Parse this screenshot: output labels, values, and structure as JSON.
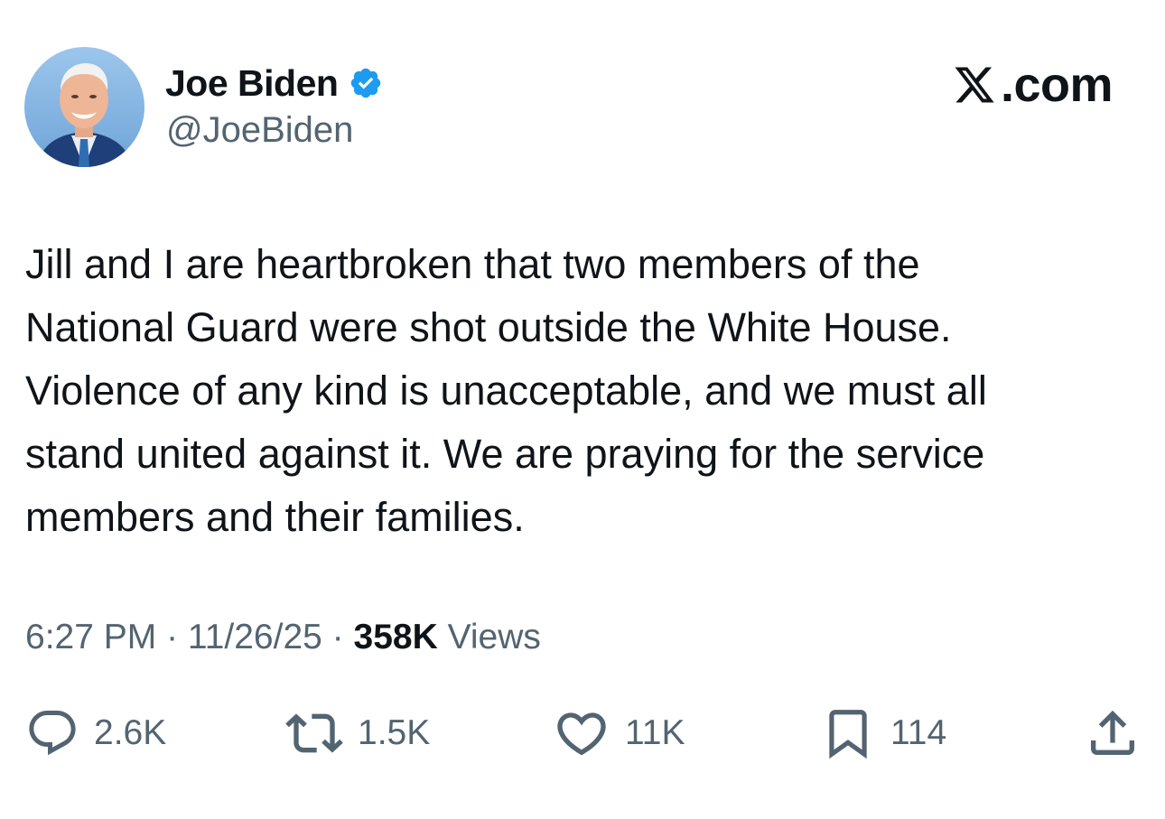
{
  "author": {
    "display_name": "Joe Biden",
    "handle": "@JoeBiden",
    "verified": true,
    "avatar_icon": "user-avatar-photo",
    "verified_icon": "verified-badge-icon"
  },
  "brand": {
    "text": ".com",
    "icon": "x-logo-icon"
  },
  "tweet": {
    "lines": [
      "Jill and I are heartbroken that two members of the",
      "National Guard were shot outside the White House.",
      "Violence of any kind is unacceptable, and we must all",
      "stand united against it. We are praying for the service",
      "members and their families."
    ]
  },
  "meta": {
    "time": "6:27 PM",
    "date": "11/26/25",
    "separator": " · ",
    "views_count": "358K",
    "views_label": " Views"
  },
  "actions": {
    "reply": {
      "count": "2.6K",
      "icon": "reply-icon"
    },
    "repost": {
      "count": "1.5K",
      "icon": "repost-icon"
    },
    "like": {
      "count": "11K",
      "icon": "heart-icon"
    },
    "bookmark": {
      "count": "114",
      "icon": "bookmark-icon"
    },
    "share": {
      "icon": "share-icon"
    }
  },
  "colors": {
    "text_primary": "#0f1419",
    "text_secondary": "#536471",
    "verified_blue": "#1d9bf0",
    "background": "#ffffff"
  }
}
